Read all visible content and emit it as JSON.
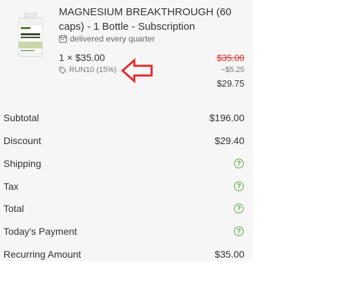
{
  "product": {
    "title": "MAGNESIUM BREAKTHROUGH (60 caps) - 1 Bottle - Subscription",
    "delivery_text": "delivered every quarter",
    "quantity_price": "1 × $35.00",
    "coupon_code": "RUN10 (15%)",
    "original_price": "$35.00",
    "discount_amount": "−$5.25",
    "line_total": "$29.75",
    "image_icon": "product-bottle-image"
  },
  "summary": {
    "subtotal_label": "Subtotal",
    "subtotal_value": "$196.00",
    "discount_label": "Discount",
    "discount_value": "$29.40",
    "shipping_label": "Shipping",
    "tax_label": "Tax",
    "total_label": "Total",
    "today_label": "Today's Payment",
    "recurring_label": "Recurring Amount",
    "recurring_value": "$35.00",
    "help_symbol": "?"
  },
  "colors": {
    "strike_price": "#e02b2b",
    "arrow": "#e02b2b",
    "help_icon": "#5aa83c",
    "panel_bg": "#f6f6f6"
  }
}
